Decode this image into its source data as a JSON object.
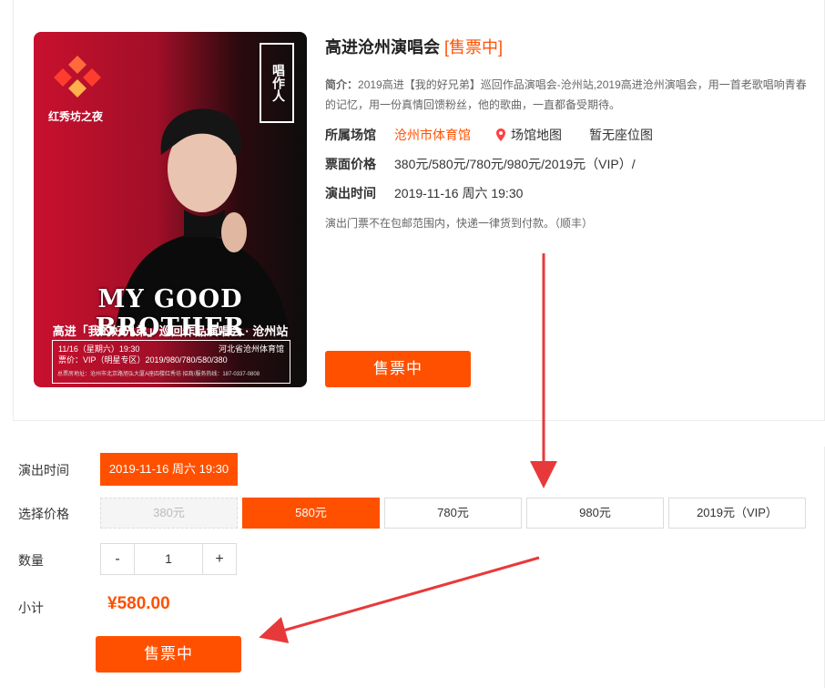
{
  "poster": {
    "logo_text": "红秀坊之夜",
    "box_text": "唱作人",
    "headline": "MY GOOD BROTHER",
    "subtitle": "高进「我的好兄弟」巡回作品演唱会 · 沧州站",
    "info_date": "11/16（星期六）19:30",
    "info_venue": "河北省沧州体育馆",
    "info_price": "票价：VIP（明星专区）2019/980/780/580/380",
    "info_fine": "总票房地址：沧州市北京路旭弘大厦A座四楼红秀坊   招商/服务热线：187-0337-0808"
  },
  "show": {
    "title": "高进沧州演唱会",
    "status": "[售票中]",
    "intro_label": "简介：",
    "intro_text": "2019高进【我的好兄弟】巡回作品演唱会-沧州站,2019高进沧州演唱会，用一首老歌唱响青春的记忆，用一份真情回馈粉丝，他的歌曲，一直都备受期待。",
    "venue_label": "所属场馆",
    "venue_name": "沧州市体育馆",
    "map_link": "场馆地图",
    "seat_map": "暂无座位图",
    "price_label": "票面价格",
    "price_text": "380元/580元/780元/980元/2019元（VIP）/",
    "time_label": "演出时间",
    "time_text": "2019-11-16 周六 19:30",
    "notice": "演出门票不在包邮范围内，快递一律货到付款。（顺丰）",
    "buy_button": "售票中"
  },
  "options": {
    "time_label": "演出时间",
    "time_value": "2019-11-16 周六 19:30",
    "price_label": "选择价格",
    "prices": [
      {
        "label": "380元",
        "state": "disabled"
      },
      {
        "label": "580元",
        "state": "selected"
      },
      {
        "label": "780元",
        "state": "normal"
      },
      {
        "label": "980元",
        "state": "normal"
      },
      {
        "label": "2019元（VIP）",
        "state": "normal"
      }
    ],
    "qty_label": "数量",
    "qty_minus": "-",
    "qty_value": "1",
    "qty_plus": "+",
    "subtotal_label": "小计",
    "subtotal_value": "¥580.00",
    "buy_button": "售票中"
  },
  "colors": {
    "accent": "#ff5000",
    "annotation_arrow": "#e8393a"
  }
}
